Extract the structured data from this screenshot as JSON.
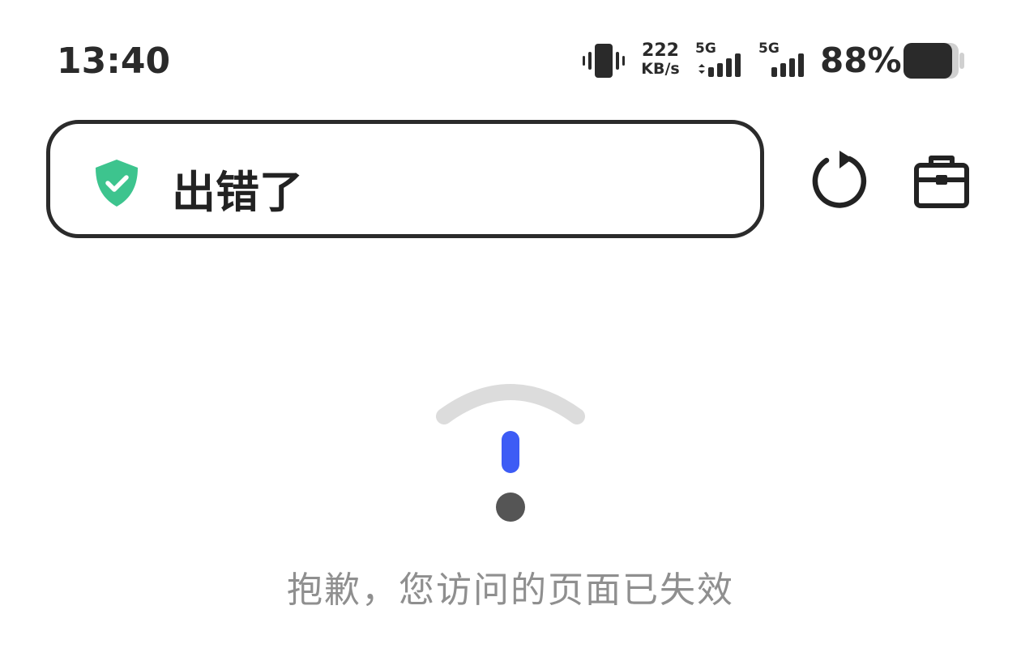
{
  "status_bar": {
    "time": "13:40",
    "net_speed_value": "222",
    "net_speed_unit": "KB/s",
    "sim1_network": "5G",
    "sim2_network": "5G",
    "battery_percent": "88%",
    "battery_level": 0.88,
    "icons": [
      "vibrate-icon",
      "signal-icon",
      "signal-icon",
      "battery-icon"
    ]
  },
  "toolbar": {
    "security_icon": "shield-check-icon",
    "page_title": "出错了",
    "refresh_icon": "refresh-icon",
    "toolbox_icon": "toolbox-icon"
  },
  "error": {
    "illustration": "exclamation-icon",
    "message": "抱歉，您访问的页面已失效"
  },
  "colors": {
    "shield": "#3dc48e",
    "exclamation_bar": "#3d5cf5",
    "exclamation_dot": "#555555",
    "arc": "#dcdcdc",
    "message_text": "#8f8f8f"
  }
}
